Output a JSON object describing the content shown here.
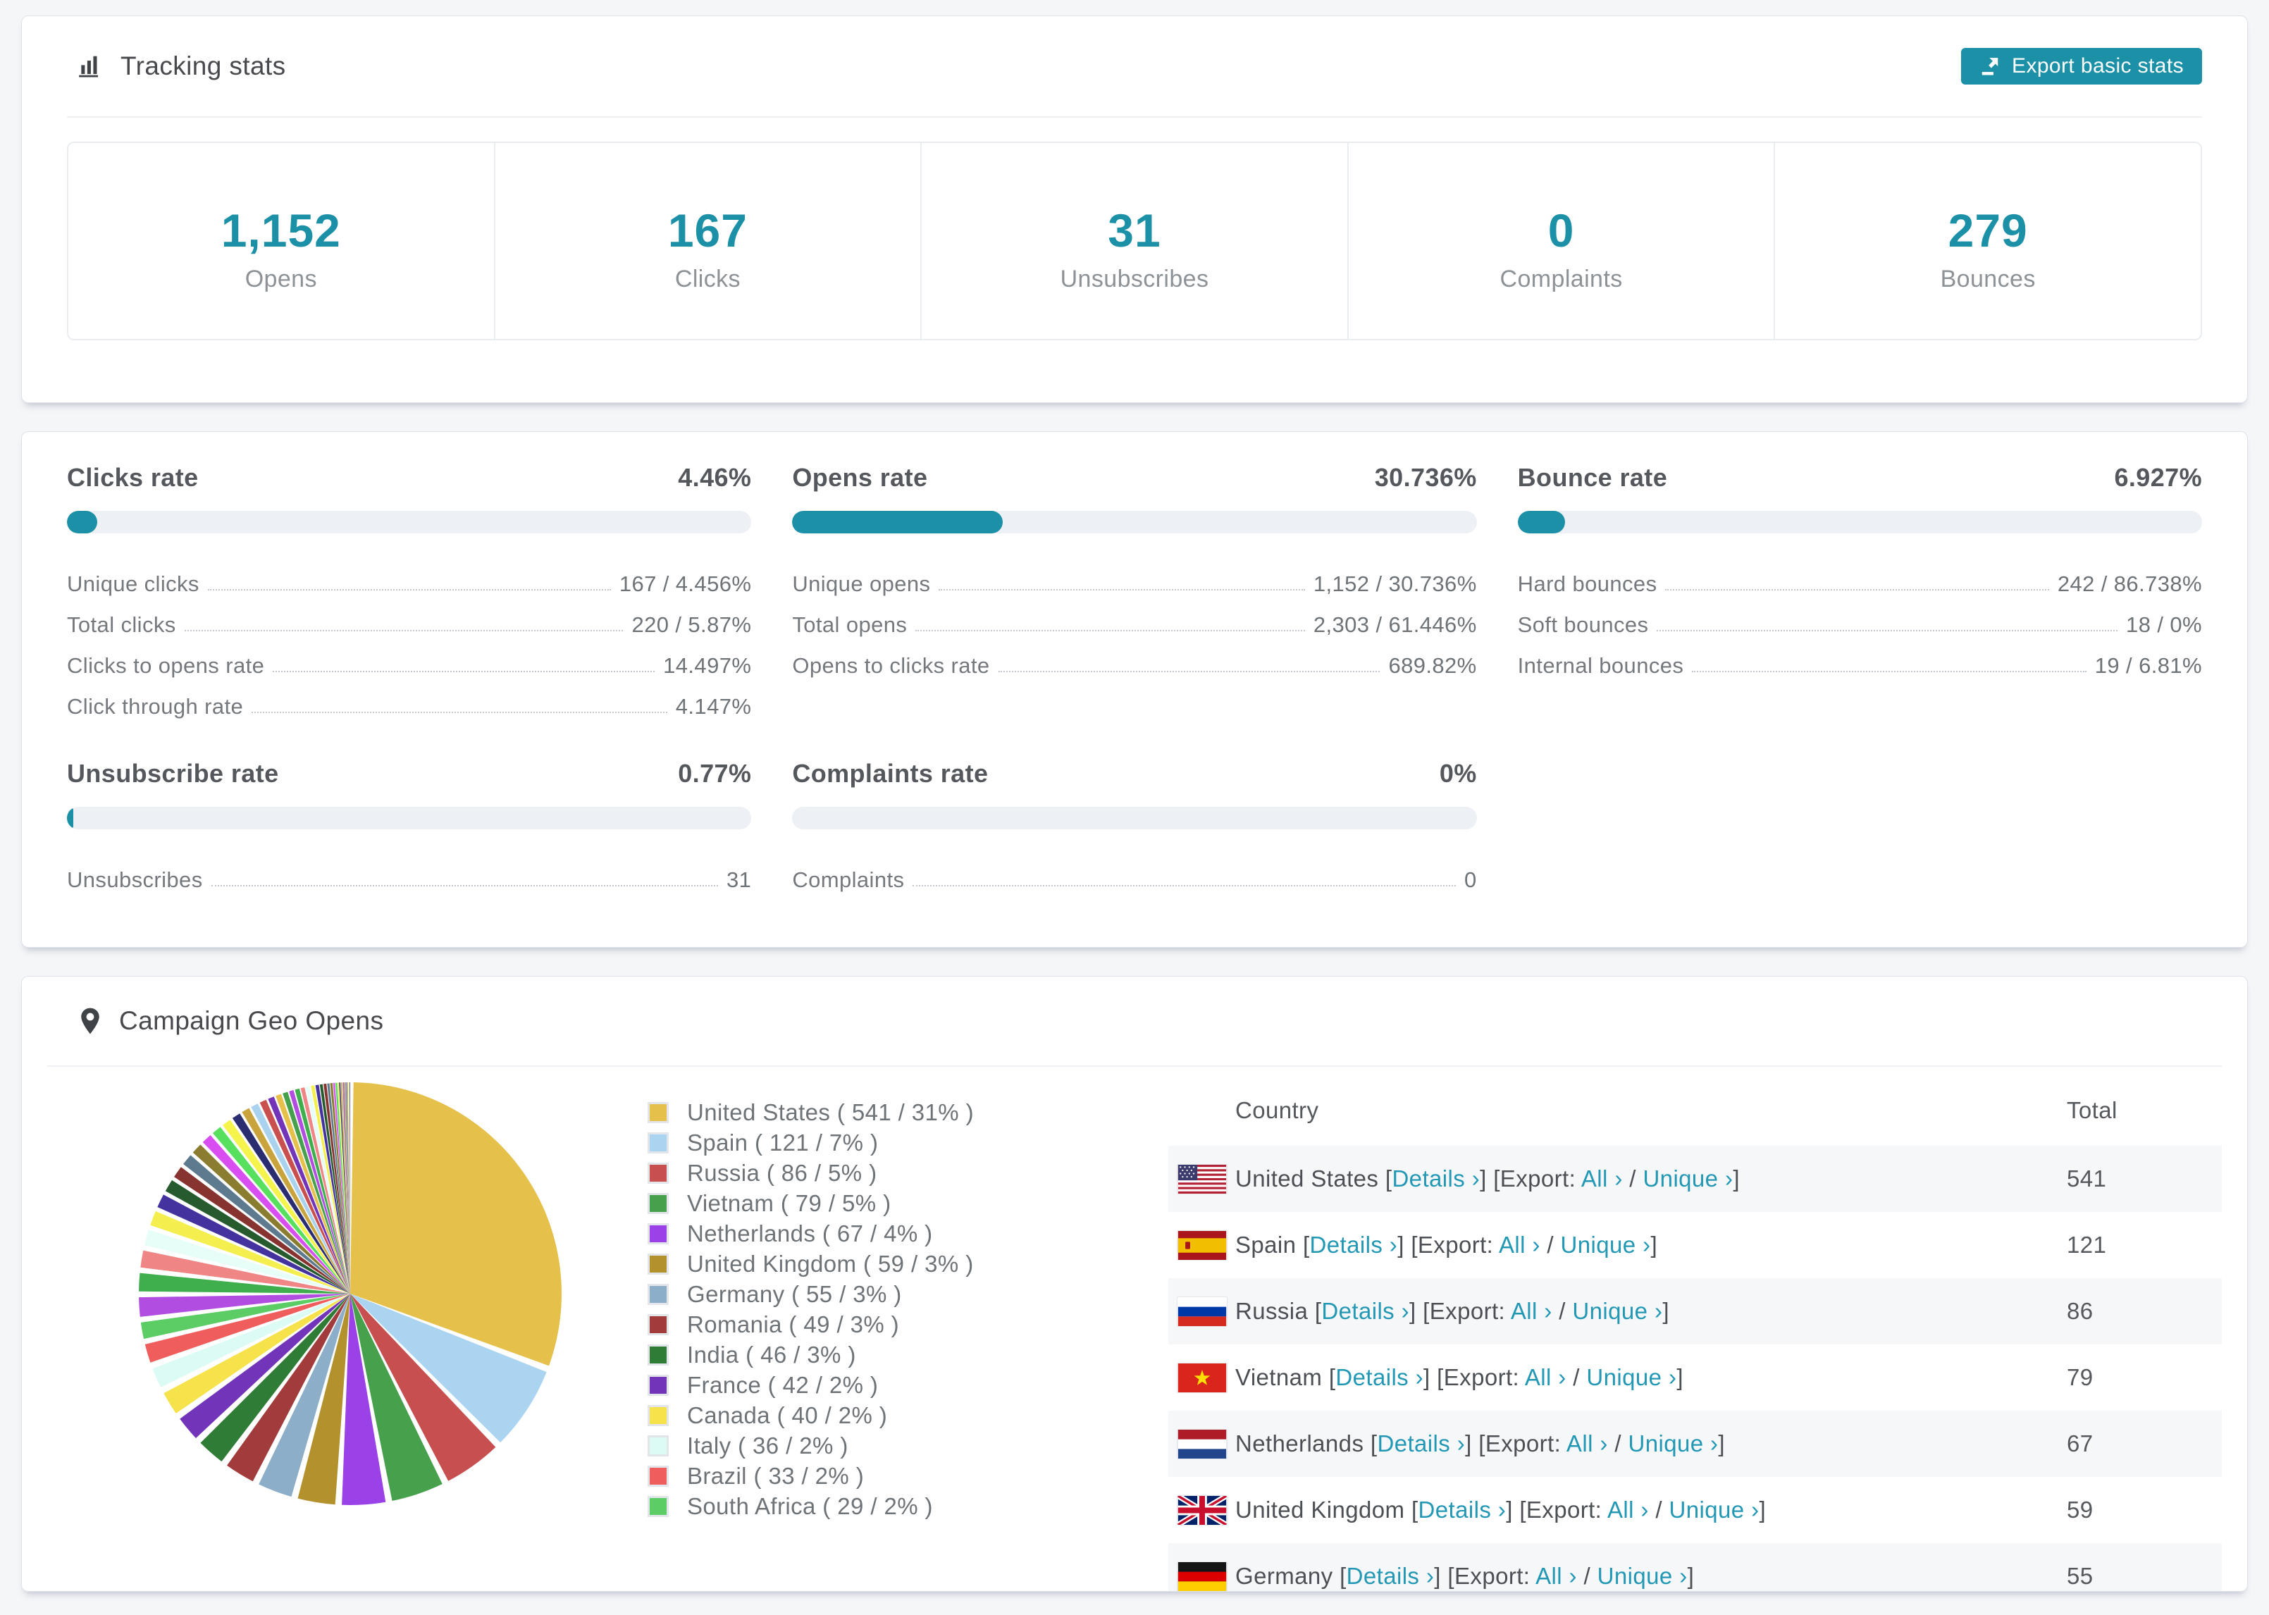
{
  "accent_color": "#1b90a7",
  "link_color": "#2398b5",
  "tracking": {
    "title": "Tracking stats",
    "export_label": "Export basic stats",
    "stats": [
      {
        "value": "1,152",
        "label": "Opens"
      },
      {
        "value": "167",
        "label": "Clicks"
      },
      {
        "value": "31",
        "label": "Unsubscribes"
      },
      {
        "value": "0",
        "label": "Complaints"
      },
      {
        "value": "279",
        "label": "Bounces"
      }
    ]
  },
  "rates": {
    "sections": [
      {
        "title": "Clicks rate",
        "value": "4.46%",
        "bar_pct": 4.46,
        "rows": [
          {
            "label": "Unique clicks",
            "value": "167 / 4.456%"
          },
          {
            "label": "Total clicks",
            "value": "220 / 5.87%"
          },
          {
            "label": "Clicks to opens rate",
            "value": "14.497%"
          },
          {
            "label": "Click through rate",
            "value": "4.147%"
          }
        ]
      },
      {
        "title": "Opens rate",
        "value": "30.736%",
        "bar_pct": 30.736,
        "rows": [
          {
            "label": "Unique opens",
            "value": "1,152 / 30.736%"
          },
          {
            "label": "Total opens",
            "value": "2,303 / 61.446%"
          },
          {
            "label": "Opens to clicks rate",
            "value": "689.82%"
          }
        ]
      },
      {
        "title": "Bounce rate",
        "value": "6.927%",
        "bar_pct": 6.927,
        "rows": [
          {
            "label": "Hard bounces",
            "value": "242 / 86.738%"
          },
          {
            "label": "Soft bounces",
            "value": "18 / 0%"
          },
          {
            "label": "Internal bounces",
            "value": "19 / 6.81%"
          }
        ]
      },
      {
        "title": "Unsubscribe rate",
        "value": "0.77%",
        "bar_pct": 0.77,
        "rows": [
          {
            "label": "Unsubscribes",
            "value": "31"
          }
        ]
      },
      {
        "title": "Complaints rate",
        "value": "0%",
        "bar_pct": 0,
        "rows": [
          {
            "label": "Complaints",
            "value": "0"
          }
        ]
      }
    ]
  },
  "geo": {
    "title": "Campaign Geo Opens",
    "links": {
      "details": "Details ›",
      "export_prefix": "Export:",
      "all": "All ›",
      "unique": "Unique ›"
    },
    "table": {
      "headers": [
        "Country",
        "Total"
      ],
      "rows": [
        {
          "country": "United States",
          "flag": "us",
          "total": "541"
        },
        {
          "country": "Spain",
          "flag": "es",
          "total": "121"
        },
        {
          "country": "Russia",
          "flag": "ru",
          "total": "86"
        },
        {
          "country": "Vietnam",
          "flag": "vn",
          "total": "79"
        },
        {
          "country": "Netherlands",
          "flag": "nl",
          "total": "67"
        },
        {
          "country": "United Kingdom",
          "flag": "gb",
          "total": "59"
        },
        {
          "country": "Germany",
          "flag": "de",
          "total": "55"
        }
      ]
    }
  },
  "chart_data": {
    "type": "pie",
    "title": "Campaign Geo Opens",
    "unit": "opens",
    "legend_position": "right",
    "start_angle_deg": -90,
    "direction": "clockwise",
    "slices": [
      {
        "label": "United States",
        "value": 541,
        "pct": 31,
        "color": "#e5c14b"
      },
      {
        "label": "Spain",
        "value": 121,
        "pct": 7,
        "color": "#abd4f1"
      },
      {
        "label": "Russia",
        "value": 86,
        "pct": 5,
        "color": "#c74f4f"
      },
      {
        "label": "Vietnam",
        "value": 79,
        "pct": 5,
        "color": "#46a04c"
      },
      {
        "label": "Netherlands",
        "value": 67,
        "pct": 4,
        "color": "#9b41e8"
      },
      {
        "label": "United Kingdom",
        "value": 59,
        "pct": 3,
        "color": "#b3922e"
      },
      {
        "label": "Germany",
        "value": 55,
        "pct": 3,
        "color": "#8caec9"
      },
      {
        "label": "Romania",
        "value": 49,
        "pct": 3,
        "color": "#a23c3c"
      },
      {
        "label": "India",
        "value": 46,
        "pct": 3,
        "color": "#2e7c35"
      },
      {
        "label": "France",
        "value": 42,
        "pct": 2,
        "color": "#7234b8"
      },
      {
        "label": "Canada",
        "value": 40,
        "pct": 2,
        "color": "#f6e24b"
      },
      {
        "label": "Italy",
        "value": 36,
        "pct": 2,
        "color": "#dcfbf5"
      },
      {
        "label": "Brazil",
        "value": 33,
        "pct": 2,
        "color": "#ef5d5d"
      },
      {
        "label": "South Africa",
        "value": 29,
        "pct": 2,
        "color": "#5bcd64"
      }
    ],
    "others": {
      "label": "Other countries (unlabeled small slices)",
      "values": [
        34,
        32,
        30,
        28,
        26,
        24,
        22,
        21,
        20,
        19,
        18,
        17,
        16,
        15,
        14,
        13,
        12,
        11,
        10,
        9,
        8,
        8,
        7,
        7,
        6,
        6,
        5,
        5,
        4,
        4,
        3,
        3,
        2,
        2,
        2,
        1,
        1,
        1,
        1,
        1,
        1,
        1,
        1,
        1,
        1,
        1
      ],
      "colors": [
        "#b24de2",
        "#3fae4c",
        "#f08585",
        "#e7fdf8",
        "#f4ef4e",
        "#44329f",
        "#265b2e",
        "#87332f",
        "#5d7a8f",
        "#8a7d30",
        "#d84ef0",
        "#57df5e",
        "#f4f44d",
        "#2b2d71",
        "#c9a43c",
        "#a9d2ef",
        "#c9504f",
        "#7234b8",
        "#e5c14b",
        "#46a04c"
      ]
    }
  }
}
